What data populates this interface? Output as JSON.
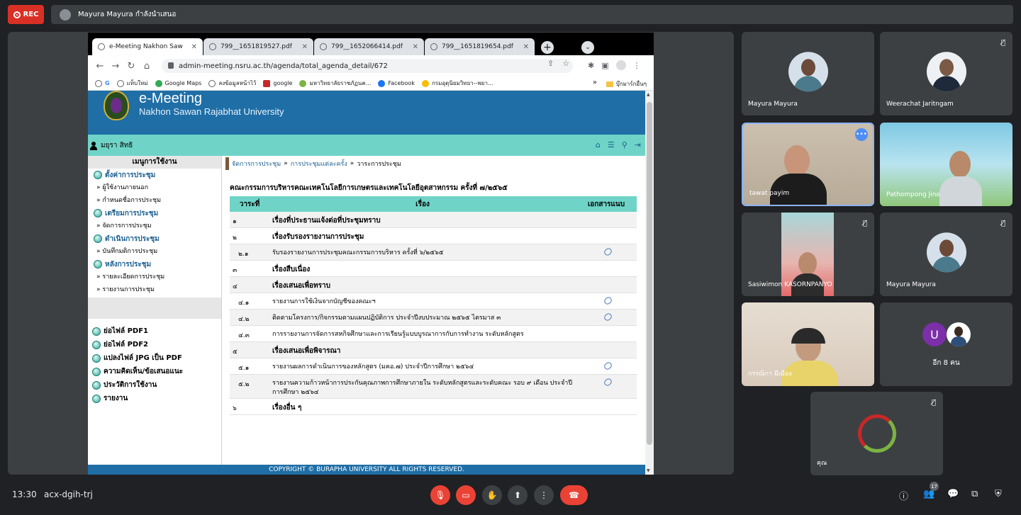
{
  "recording": {
    "label": "REC"
  },
  "presenting": {
    "text": "Mayura Mayura กำลังนำเสนอ"
  },
  "browser": {
    "tabs": [
      {
        "title": "e-Meeting Nakhon Sawan R",
        "active": true
      },
      {
        "title": "799__1651819527.pdf",
        "active": false
      },
      {
        "title": "799__1652066414.pdf",
        "active": false
      },
      {
        "title": "799__1651819654.pdf",
        "active": false
      }
    ],
    "url": "admin-meeting.nsru.ac.th/agenda/total_agenda_detail/672",
    "bookmarks": [
      "แท็บใหม่",
      "Google Maps",
      "ลงข้อมูลหน้าไว้",
      "google",
      "มหาวิทยาลัยราชภัฏนค...",
      "Facebook",
      "กรมอุตุนิยมวิทยา--พยา..."
    ],
    "bookmark_folder": "บุ๊กมาร์กอื่นๆ"
  },
  "site": {
    "title": "e-Meeting",
    "subtitle": "Nakhon Sawan Rajabhat University",
    "user": "มยุรา สิทธิ",
    "footer": "COPYRIGHT © BURAPHA UNIVERSITY ALL RIGHTS RESERVED."
  },
  "sidebar": {
    "header": "เมนูการใช้งาน",
    "sections": [
      {
        "title": "ตั้งค่าการประชุม",
        "items": [
          "ผู้ใช้งานภายนอก",
          "กำหนดชื่อการประชุม"
        ]
      },
      {
        "title": "เตรียมการประชุม",
        "items": [
          "จัดการการประชุม"
        ]
      },
      {
        "title": "ดำเนินการประชุม",
        "items": [
          "บันทึกมติการประชุม"
        ]
      },
      {
        "title": "หลังการประชุม",
        "items": [
          "รายละเอียดการประชุม",
          "รายงานการประชุม"
        ]
      }
    ],
    "tools": [
      "ย่อไฟล์ PDF1",
      "ย่อไฟล์ PDF2",
      "แปลงไฟล์ JPG เป็น PDF",
      "ความคิดเห็น/ข้อเสนอแนะ",
      "ประวัติการใช้งาน",
      "รายงาน"
    ]
  },
  "breadcrumb": {
    "items": [
      "จัดการการประชุม",
      "การประชุมแต่ละครั้ง",
      "วาระการประชุม"
    ]
  },
  "meeting_title": "คณะกรรมการบริหารคณะเทคโนโลยีการเกษตรและเทคโนโลยีอุตสาหกรรม ครั้งที่ ๗/๒๕๖๕",
  "agenda": {
    "headers": [
      "วาระที่",
      "เรื่อง",
      "เอกสารแนบ"
    ],
    "rows": [
      {
        "no": "๑",
        "title": "เรื่องที่ประธานแจ้งต่อที่ประชุมทราบ",
        "level": "main",
        "attach": false
      },
      {
        "no": "๒",
        "title": "เรื่องรับรองรายงานการประชุม",
        "level": "main",
        "attach": false
      },
      {
        "no": "๒.๑",
        "title": "รับรองรายงานการประชุมคณะกรรมการบริหาร ครั้งที่ ๖/๒๕๖๕",
        "level": "sub",
        "attach": true
      },
      {
        "no": "๓",
        "title": "เรื่องสืบเนื่อง",
        "level": "main",
        "attach": false
      },
      {
        "no": "๔",
        "title": "เรื่องเสนอเพื่อทราบ",
        "level": "main",
        "attach": false
      },
      {
        "no": "๔.๑",
        "title": "รายงานการใช้เงินจากบัญชีของคณะฯ",
        "level": "sub",
        "attach": true
      },
      {
        "no": "๔.๒",
        "title": "ติดตามโครงการ/กิจกรรมตามแผนปฏิบัติการ ประจำปีงบประมาณ ๒๕๖๕ ไตรมาส ๓",
        "level": "sub",
        "attach": true
      },
      {
        "no": "๔.๓",
        "title": "การรายงานการจัดการสหกิจศึกษาและการเรียนรู้แบบบูรณาการกับการทำงาน ระดับหลักสูตร",
        "level": "sub",
        "attach": false
      },
      {
        "no": "๕",
        "title": "เรื่องเสนอเพื่อพิจารณา",
        "level": "main",
        "attach": false
      },
      {
        "no": "๕.๑",
        "title": "รายงานผลการดำเนินการของหลักสูตร (มคอ.๗) ประจำปีการศึกษา ๒๕๖๔",
        "level": "sub",
        "attach": true
      },
      {
        "no": "๕.๒",
        "title": "รายงานความก้าวหน้าการประกันคุณภาพการศึกษาภายใน ระดับหลักสูตรและระดับคณะ รอบ ๙ เดือน ประจำปีการศึกษา ๒๕๖๔",
        "level": "sub",
        "attach": true
      },
      {
        "no": "๖",
        "title": "เรื่องอื่น ๆ",
        "level": "main",
        "attach": false
      }
    ]
  },
  "participants": [
    {
      "name": "Mayura Mayura"
    },
    {
      "name": "Weerachat Jaritngam"
    },
    {
      "name": "tawat payim"
    },
    {
      "name": "Pathompong Jino"
    },
    {
      "name": "Sasiwimon KASORNPANYO"
    },
    {
      "name": "Mayura Mayura"
    },
    {
      "name": "กรรณิกา มีเมือง"
    },
    {
      "name": "อีก 8 คน",
      "initial": "U"
    },
    {
      "name": "คุณ"
    }
  ],
  "bottom_bar": {
    "time": "13:30",
    "meeting_code": "acx-dgih-trj",
    "participant_count": "17"
  }
}
